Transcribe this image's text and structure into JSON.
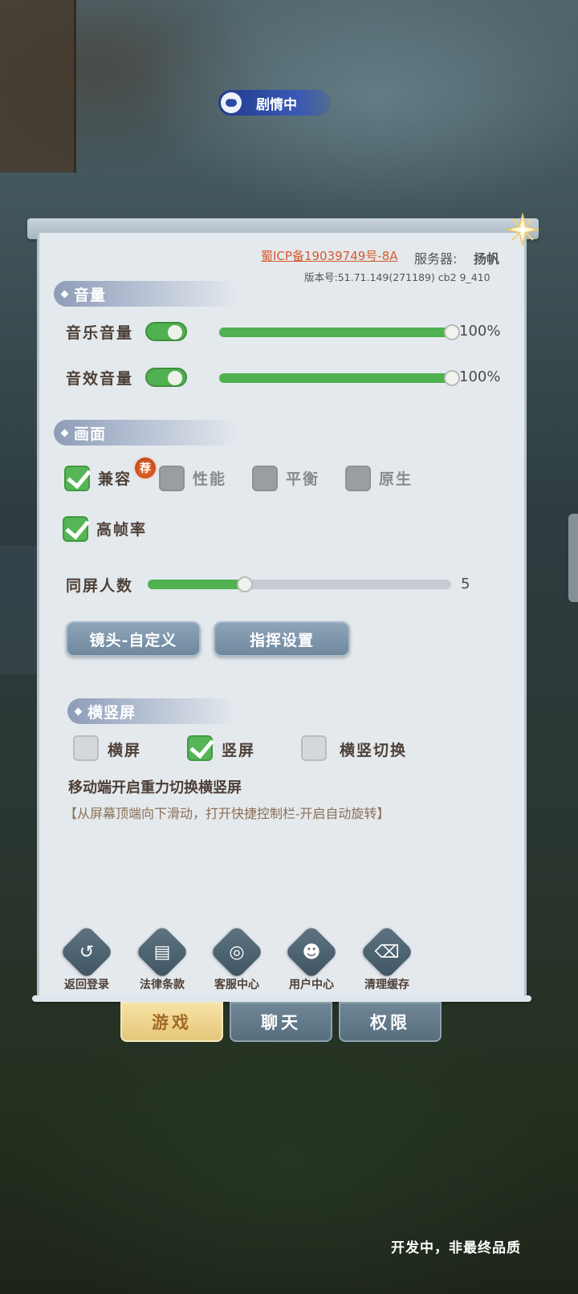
{
  "status": {
    "story_label": "剧情中"
  },
  "header": {
    "icp": "蜀ICP备19039749号-8A",
    "server_label": "服务器:",
    "server_value": "扬帆",
    "version": "版本号:51.71.149(271189) cb2 9_410"
  },
  "volume": {
    "title": "音量",
    "music": {
      "label": "音乐音量",
      "enabled": true,
      "value": 100,
      "display": "100%"
    },
    "sfx": {
      "label": "音效音量",
      "enabled": true,
      "value": 100,
      "display": "100%"
    }
  },
  "graphics": {
    "title": "画面",
    "quality_options": [
      {
        "label": "兼容",
        "checked": true,
        "badge": "荐"
      },
      {
        "label": "性能",
        "checked": false
      },
      {
        "label": "平衡",
        "checked": false
      },
      {
        "label": "原生",
        "checked": false
      }
    ],
    "high_fps": {
      "label": "高帧率",
      "checked": true
    },
    "players_on_screen": {
      "label": "同屏人数",
      "value": 5,
      "fraction": 0.32
    },
    "buttons": {
      "camera": "镜头-自定义",
      "command": "指挥设置"
    }
  },
  "orientation": {
    "title": "横竖屏",
    "options": [
      {
        "label": "横屏",
        "checked": false
      },
      {
        "label": "竖屏",
        "checked": true
      },
      {
        "label": "横竖切换",
        "checked": false
      }
    ],
    "hint_title": "移动端开启重力切换横竖屏",
    "hint_sub": "【从屏幕顶端向下滑动，打开快捷控制栏-开启自动旋转】"
  },
  "footer": [
    {
      "label": "返回登录",
      "icon": "return-login-icon",
      "glyph": "↺"
    },
    {
      "label": "法律条款",
      "icon": "document-icon",
      "glyph": "▤"
    },
    {
      "label": "客服中心",
      "icon": "headset-icon",
      "glyph": "◎"
    },
    {
      "label": "用户中心",
      "icon": "user-icon",
      "glyph": "☻"
    },
    {
      "label": "清理缓存",
      "icon": "broom-icon",
      "glyph": "⌫"
    }
  ],
  "tabs": [
    {
      "label": "游戏",
      "active": true
    },
    {
      "label": "聊天",
      "active": false
    },
    {
      "label": "权限",
      "active": false
    }
  ],
  "watermark": "开发中，非最终品质",
  "colors": {
    "accent_green": "#4fb14f",
    "tab_active": "#e5c679",
    "link": "#d55a2e"
  }
}
